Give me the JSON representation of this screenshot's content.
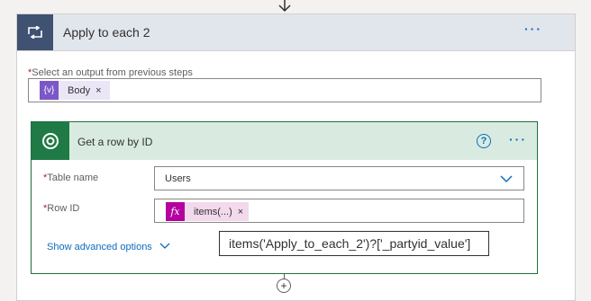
{
  "loop": {
    "title": "Apply to each 2",
    "icon": "loop-icon",
    "more_label": "···",
    "select_label": "Select an output from previous steps",
    "required_mark": "*",
    "token_label": "Body",
    "token_icon_text": "{v}",
    "token_remove": "×"
  },
  "action": {
    "title": "Get a row by ID",
    "icon": "dataverse-icon",
    "help_label": "?",
    "more_label": "···",
    "table_label": "Table name",
    "table_value": "Users",
    "row_label": "Row ID",
    "row_token_label": "items(...)",
    "row_token_icon": "fx",
    "row_token_remove": "×",
    "advanced_label": "Show advanced options"
  },
  "tooltip": {
    "text": "items('Apply_to_each_2')?['_partyid_value']"
  },
  "add_step_label": "+",
  "colors": {
    "loop_header": "#e1e5ec",
    "loop_icon": "#3f5272",
    "action_header": "#d9ebe0",
    "action_icon": "#1f7a46",
    "accent": "#0f6cbd"
  }
}
